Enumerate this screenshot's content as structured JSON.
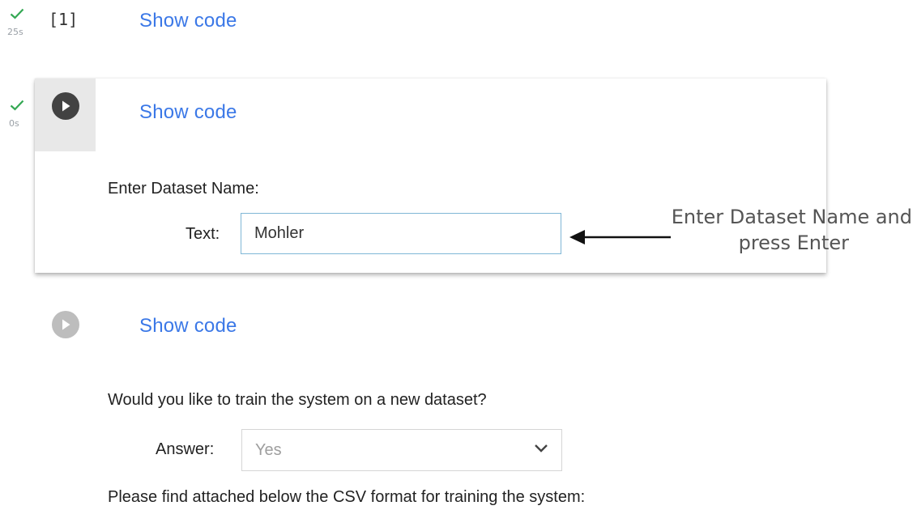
{
  "cell1": {
    "status_icon": "check-icon",
    "status_time": "25s",
    "exec_count": "[1]",
    "show_code_label": "Show code"
  },
  "cell2": {
    "status_icon": "check-icon",
    "status_time": "0s",
    "run_icon": "play-icon",
    "show_code_label": "Show code",
    "form_title": "Enter Dataset Name:",
    "text_field_label": "Text:",
    "text_field_value": "Mohler"
  },
  "annotation": {
    "line1": "Enter Dataset Name and",
    "line2": "press Enter",
    "arrow_icon": "arrow-left-icon"
  },
  "cell3": {
    "run_icon": "play-icon",
    "show_code_label": "Show code",
    "question": "Would you like to train the system on a new dataset?",
    "answer_label": "Answer:",
    "answer_value": "Yes",
    "dropdown_icon": "chevron-down-icon",
    "footer_text": "Please find attached below the CSV format for training the system:"
  },
  "colors": {
    "link_blue": "#3b78e7",
    "success_green": "#34a853",
    "run_button_active": "#424242",
    "run_button_inactive": "#bdbdbd",
    "input_border_focus": "#7fb7d6"
  }
}
